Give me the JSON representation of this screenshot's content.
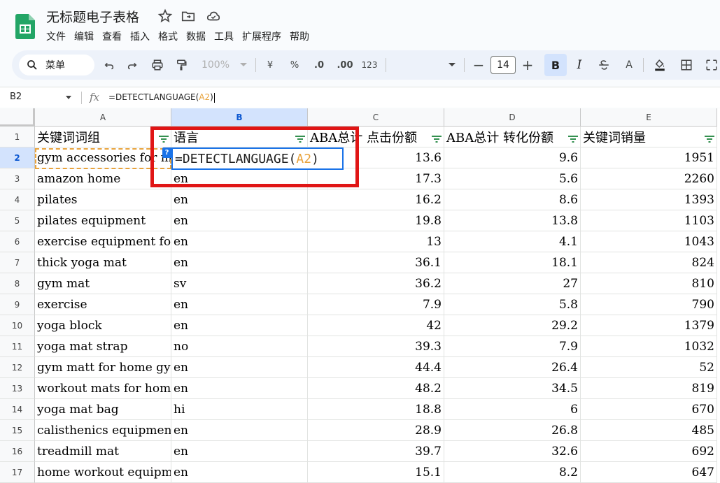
{
  "app": {
    "title": "无标题电子表格"
  },
  "menu": [
    "文件",
    "编辑",
    "查看",
    "插入",
    "格式",
    "数据",
    "工具",
    "扩展程序",
    "帮助"
  ],
  "toolbar": {
    "search_label": "菜单",
    "zoom": "100%",
    "currency": "¥",
    "percent": "%",
    "dec_decrease": ".0",
    "dec_increase": ".00",
    "number_format": "123",
    "font_size": "14",
    "bold": "B",
    "italic": "I",
    "text_color": "A"
  },
  "formula_bar": {
    "cell_ref": "B2",
    "fx": "fx",
    "formula_prefix": "=DETECTLANGUAGE(",
    "formula_ref": "A2",
    "formula_suffix": ")"
  },
  "editor": {
    "help": "?",
    "prefix": "=DETECTLANGUAGE(",
    "ref": "A2",
    "suffix": ")"
  },
  "columns": [
    "A",
    "B",
    "C",
    "D",
    "E"
  ],
  "selected_column": "B",
  "selected_row": 2,
  "header_row": [
    "关键词词组",
    "语言",
    "ABA总计 点击份额",
    "ABA总计 转化份额",
    "关键词销量"
  ],
  "rows": [
    [
      "gym accessories for men",
      "",
      "13.6",
      "9.6",
      "1951"
    ],
    [
      "amazon home",
      "en",
      "17.3",
      "5.6",
      "2260"
    ],
    [
      "pilates",
      "en",
      "16.2",
      "8.6",
      "1393"
    ],
    [
      "pilates equipment",
      "en",
      "19.8",
      "13.8",
      "1103"
    ],
    [
      "exercise equipment for home",
      "en",
      "13",
      "4.1",
      "1043"
    ],
    [
      "thick yoga mat",
      "en",
      "36.1",
      "18.1",
      "824"
    ],
    [
      "gym mat",
      "sv",
      "36.2",
      "27",
      "810"
    ],
    [
      "exercise",
      "en",
      "7.9",
      "5.8",
      "790"
    ],
    [
      "yoga block",
      "en",
      "42",
      "29.2",
      "1379"
    ],
    [
      "yoga mat strap",
      "no",
      "39.3",
      "7.9",
      "1032"
    ],
    [
      "gym matt for home gym",
      "en",
      "44.4",
      "26.4",
      "52"
    ],
    [
      "workout mats for home",
      "en",
      "48.2",
      "34.5",
      "819"
    ],
    [
      "yoga mat bag",
      "hi",
      "18.8",
      "6",
      "670"
    ],
    [
      "calisthenics equipment",
      "en",
      "28.9",
      "26.8",
      "485"
    ],
    [
      "treadmill mat",
      "en",
      "39.7",
      "32.6",
      "692"
    ],
    [
      "home workout equipment",
      "en",
      "15.1",
      "8.2",
      "647"
    ]
  ],
  "colors": {
    "selection": "#d3e3fd",
    "accent": "#1a73e8",
    "ref_highlight": "#e8a33d",
    "annotation_red": "#e01515"
  }
}
